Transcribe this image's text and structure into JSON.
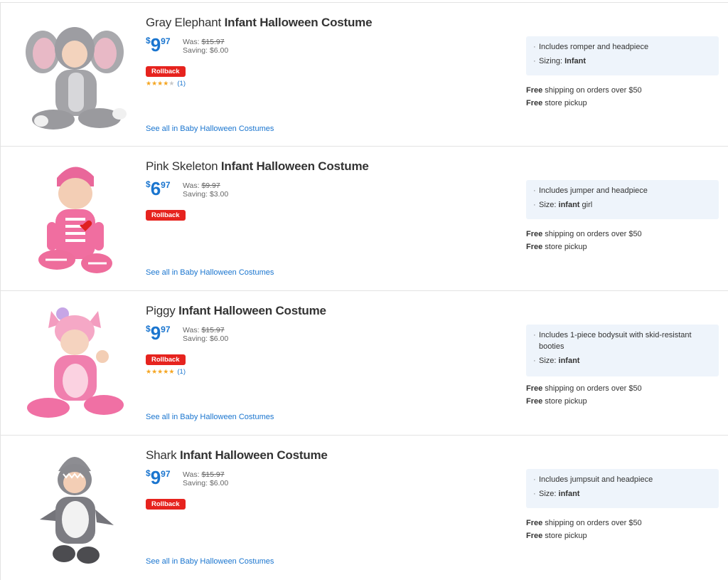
{
  "products": [
    {
      "name_plain": "Gray Elephant",
      "name_bold": "Infant Halloween Costume",
      "currency": "$",
      "price_dollars": "9",
      "price_cents": "97",
      "was_label": "Was:",
      "was_price": "$15.97",
      "saving": "Saving: $6.00",
      "badge": "Rollback",
      "rating": 4,
      "reviews": "(1)",
      "see_all": "See all in Baby Halloween Costumes",
      "features": [
        {
          "text": "Includes romper and headpiece",
          "bold": ""
        },
        {
          "text": "Sizing: ",
          "bold": "Infant"
        }
      ],
      "shipping_bold": "Free",
      "shipping_text": " shipping on orders over $50",
      "pickup_bold": "Free",
      "pickup_text": " store pickup",
      "image": "gray-elephant-costume-photo"
    },
    {
      "name_plain": "Pink Skeleton",
      "name_bold": "Infant Halloween Costume",
      "currency": "$",
      "price_dollars": "6",
      "price_cents": "97",
      "was_label": "Was:",
      "was_price": "$9.97",
      "saving": "Saving: $3.00",
      "badge": "Rollback",
      "rating": null,
      "reviews": "",
      "see_all": "See all in Baby Halloween Costumes",
      "features": [
        {
          "text": "Includes jumper and headpiece",
          "bold": ""
        },
        {
          "text": "Size: ",
          "bold": "infant",
          "after": " girl"
        }
      ],
      "shipping_bold": "Free",
      "shipping_text": " shipping on orders over $50",
      "pickup_bold": "Free",
      "pickup_text": " store pickup",
      "image": "pink-skeleton-costume-photo"
    },
    {
      "name_plain": "Piggy",
      "name_bold": "Infant Halloween Costume",
      "currency": "$",
      "price_dollars": "9",
      "price_cents": "97",
      "was_label": "Was:",
      "was_price": "$15.97",
      "saving": "Saving: $6.00",
      "badge": "Rollback",
      "rating": 5,
      "reviews": "(1)",
      "see_all": "See all in Baby Halloween Costumes",
      "features": [
        {
          "text": "Includes 1-piece bodysuit with skid-resistant booties",
          "bold": ""
        },
        {
          "text": "Size: ",
          "bold": "infant"
        }
      ],
      "shipping_bold": "Free",
      "shipping_text": " shipping on orders over $50",
      "pickup_bold": "Free",
      "pickup_text": " store pickup",
      "image": "piggy-costume-photo"
    },
    {
      "name_plain": "Shark",
      "name_bold": "Infant Halloween Costume",
      "currency": "$",
      "price_dollars": "9",
      "price_cents": "97",
      "was_label": "Was:",
      "was_price": "$15.97",
      "saving": "Saving: $6.00",
      "badge": "Rollback",
      "rating": null,
      "reviews": "",
      "see_all": "See all in Baby Halloween Costumes",
      "features": [
        {
          "text": "Includes jumpsuit and headpiece",
          "bold": ""
        },
        {
          "text": "Size: ",
          "bold": "infant"
        }
      ],
      "shipping_bold": "Free",
      "shipping_text": " shipping on orders over $50",
      "pickup_bold": "Free",
      "pickup_text": " store pickup",
      "image": "shark-costume-photo"
    }
  ],
  "colors": {
    "accent": "#1a75cf",
    "rollback": "#e6231e",
    "star": "#f5a623",
    "feature_bg": "#eef4fb"
  }
}
